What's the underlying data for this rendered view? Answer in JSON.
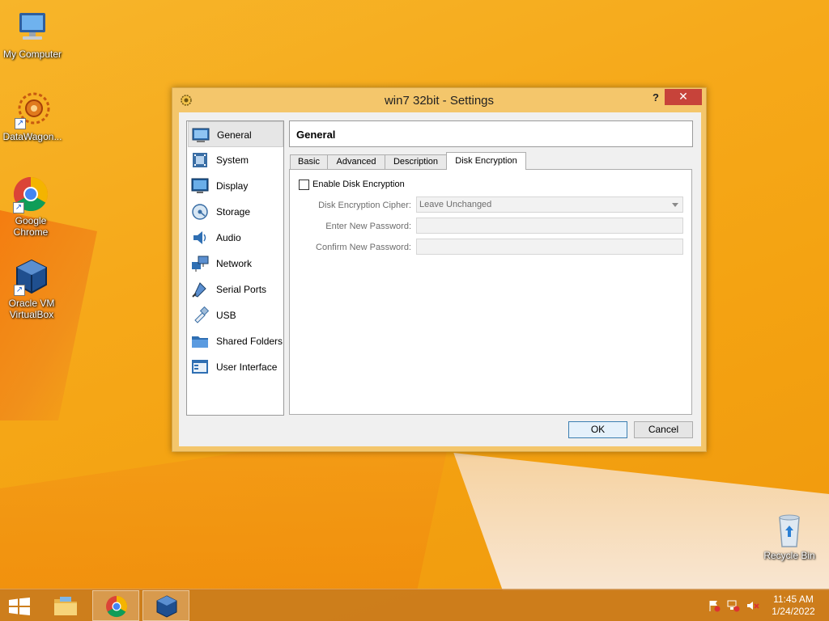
{
  "desktop": {
    "icons": [
      {
        "label": "My Computer"
      },
      {
        "label": "DataWagon..."
      },
      {
        "label": "Google Chrome"
      },
      {
        "label": "Oracle VM VirtualBox"
      },
      {
        "label": "Recycle Bin"
      }
    ]
  },
  "dialog": {
    "title": "win7 32bit - Settings",
    "help_label": "?",
    "close_label": "✕",
    "sidebar": {
      "items": [
        {
          "label": "General",
          "icon": "general-icon",
          "selected": true
        },
        {
          "label": "System",
          "icon": "system-icon"
        },
        {
          "label": "Display",
          "icon": "display-icon"
        },
        {
          "label": "Storage",
          "icon": "storage-icon"
        },
        {
          "label": "Audio",
          "icon": "audio-icon"
        },
        {
          "label": "Network",
          "icon": "network-icon"
        },
        {
          "label": "Serial Ports",
          "icon": "serial-ports-icon"
        },
        {
          "label": "USB",
          "icon": "usb-icon"
        },
        {
          "label": "Shared Folders",
          "icon": "shared-folders-icon"
        },
        {
          "label": "User Interface",
          "icon": "user-interface-icon"
        }
      ]
    },
    "page_title": "General",
    "tabs": [
      {
        "label": "Basic"
      },
      {
        "label": "Advanced"
      },
      {
        "label": "Description"
      },
      {
        "label": "Disk Encryption",
        "active": true
      }
    ],
    "disk_encryption": {
      "enable_label": "Enable Disk Encryption",
      "enabled": false,
      "cipher_label": "Disk Encryption Cipher:",
      "cipher_value": "Leave Unchanged",
      "new_password_label": "Enter New Password:",
      "new_password_value": "",
      "confirm_password_label": "Confirm New Password:",
      "confirm_password_value": ""
    },
    "buttons": {
      "ok": "OK",
      "cancel": "Cancel"
    }
  },
  "taskbar": {
    "apps": [
      {
        "name": "file-explorer-icon"
      },
      {
        "name": "chrome-icon"
      },
      {
        "name": "virtualbox-icon",
        "active": true
      }
    ],
    "clock": {
      "time": "11:45 AM",
      "date": "1/24/2022"
    }
  },
  "colors": {
    "desktop_orange": "#f6a91a",
    "dialog_frame": "#f4c66b",
    "close_button": "#c7433a",
    "default_button_border": "#3c7fb1"
  }
}
